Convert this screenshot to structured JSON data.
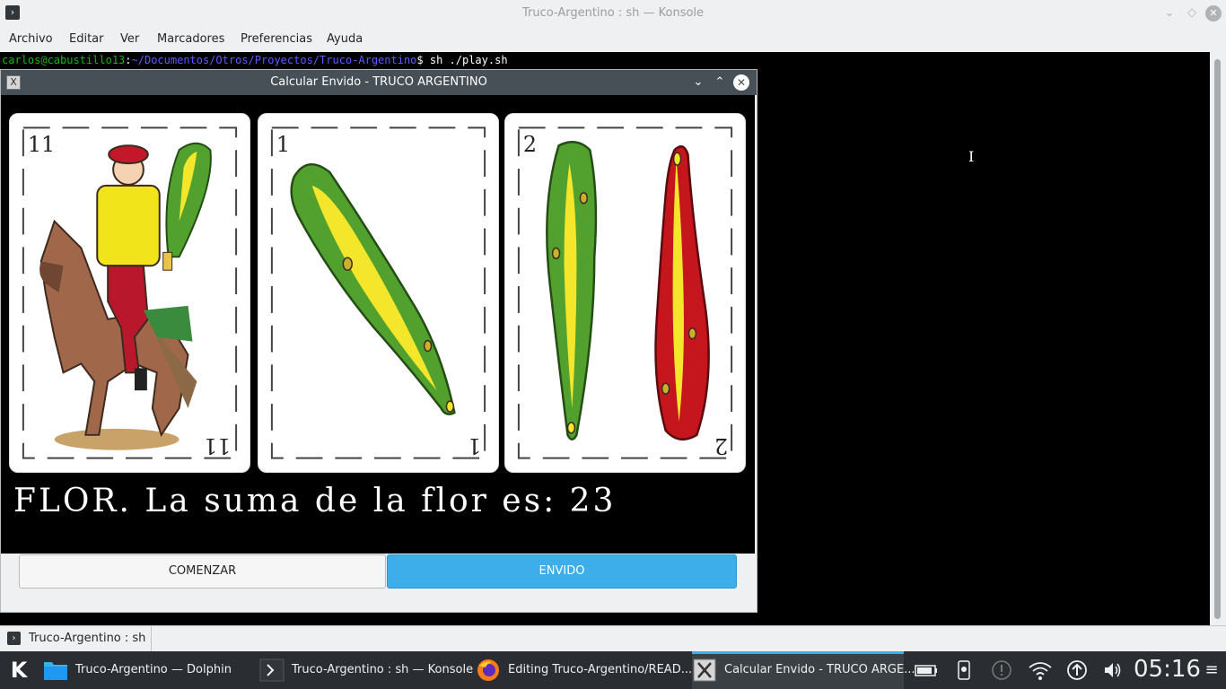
{
  "konsole": {
    "title": "Truco-Argentino : sh — Konsole",
    "menu": [
      "Archivo",
      "Editar",
      "Ver",
      "Marcadores",
      "Preferencias",
      "Ayuda"
    ],
    "prompt_user": "carlos@cabustillo13",
    "prompt_sep": ":",
    "prompt_path": "~/Documentos/Otros/Proyectos/Truco-Argentino",
    "prompt_cmd": "$ sh ./play.sh",
    "tab_label": "Truco-Argentino : sh"
  },
  "dialog": {
    "title": "Calcular Envido - TRUCO ARGENTINO",
    "result": "FLOR. La suma de la flor es: 23",
    "buttons": {
      "start": "COMENZAR",
      "envido": "ENVIDO"
    },
    "cards": [
      {
        "number": "11",
        "suit": "basto",
        "figure": "caballo"
      },
      {
        "number": "1",
        "suit": "basto"
      },
      {
        "number": "2",
        "suit": "basto"
      }
    ]
  },
  "taskbar": {
    "tasks": [
      {
        "label": "Truco-Argentino — Dolphin",
        "icon": "folder-icon"
      },
      {
        "label": "Truco-Argentino : sh — Konsole",
        "icon": "terminal-icon"
      },
      {
        "label": "Editing Truco-Argentino/READ...",
        "icon": "firefox-icon"
      },
      {
        "label": "Calcular Envido - TRUCO ARGE...",
        "icon": "x-window-icon",
        "active": true
      }
    ],
    "clock": "05:16"
  }
}
